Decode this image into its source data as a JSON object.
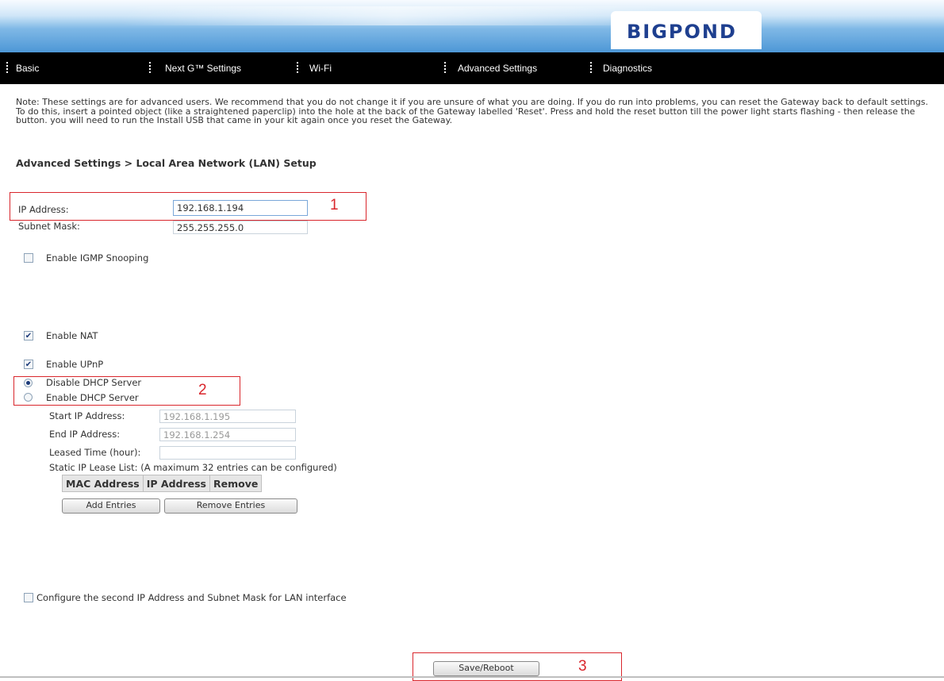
{
  "header": {
    "logo_text": "BIGPOND",
    "logo_icon": "bigpond-logo"
  },
  "nav": [
    {
      "label": "Basic"
    },
    {
      "label": "Next G™ Settings"
    },
    {
      "label": "Wi-Fi"
    },
    {
      "label": "Advanced Settings"
    },
    {
      "label": "Diagnostics"
    }
  ],
  "note": "Note: These settings are for advanced users. We recommend that you do not change it if you are unsure of what you are doing. If you do run into problems, you can reset the Gateway back to default settings. To do this, insert a pointed object (like a straightened paperclip) into the hole at the back of the Gateway labelled 'Reset'. Press and hold the reset button till the power light starts flashing - then release the button. you will need to run the Install USB that came in your kit again once you reset the Gateway.",
  "heading": "Advanced Settings > Local Area Network (LAN) Setup",
  "lan": {
    "ip_label": "IP Address:",
    "ip_value": "192.168.1.194",
    "subnet_label": "Subnet Mask:",
    "subnet_value": "255.255.255.0"
  },
  "options": {
    "igmp": {
      "label": "Enable IGMP Snooping",
      "checked": false
    },
    "nat": {
      "label": "Enable NAT",
      "checked": true
    },
    "upnp": {
      "label": "Enable UPnP",
      "checked": true
    }
  },
  "dhcp": {
    "disable_label": "Disable DHCP Server",
    "enable_label": "Enable DHCP Server",
    "selected": "disable",
    "start_label": "Start IP Address:",
    "start_value": "192.168.1.195",
    "end_label": "End IP Address:",
    "end_value": "192.168.1.254",
    "lease_label": "Leased Time (hour):",
    "lease_value": "",
    "static_label": "Static IP Lease List: (A maximum 32 entries can be configured)",
    "columns": [
      "MAC Address",
      "IP Address",
      "Remove"
    ],
    "add_button": "Add Entries",
    "remove_button": "Remove Entries"
  },
  "second_ip": {
    "label": "Configure the second IP Address and Subnet Mask for LAN interface",
    "checked": false
  },
  "save_button": "Save/Reboot",
  "callouts": {
    "one": "1",
    "two": "2",
    "three": "3"
  },
  "colors": {
    "nav_bg": "#000000",
    "callout": "#d9262c",
    "logo": "#1e3f8f"
  }
}
